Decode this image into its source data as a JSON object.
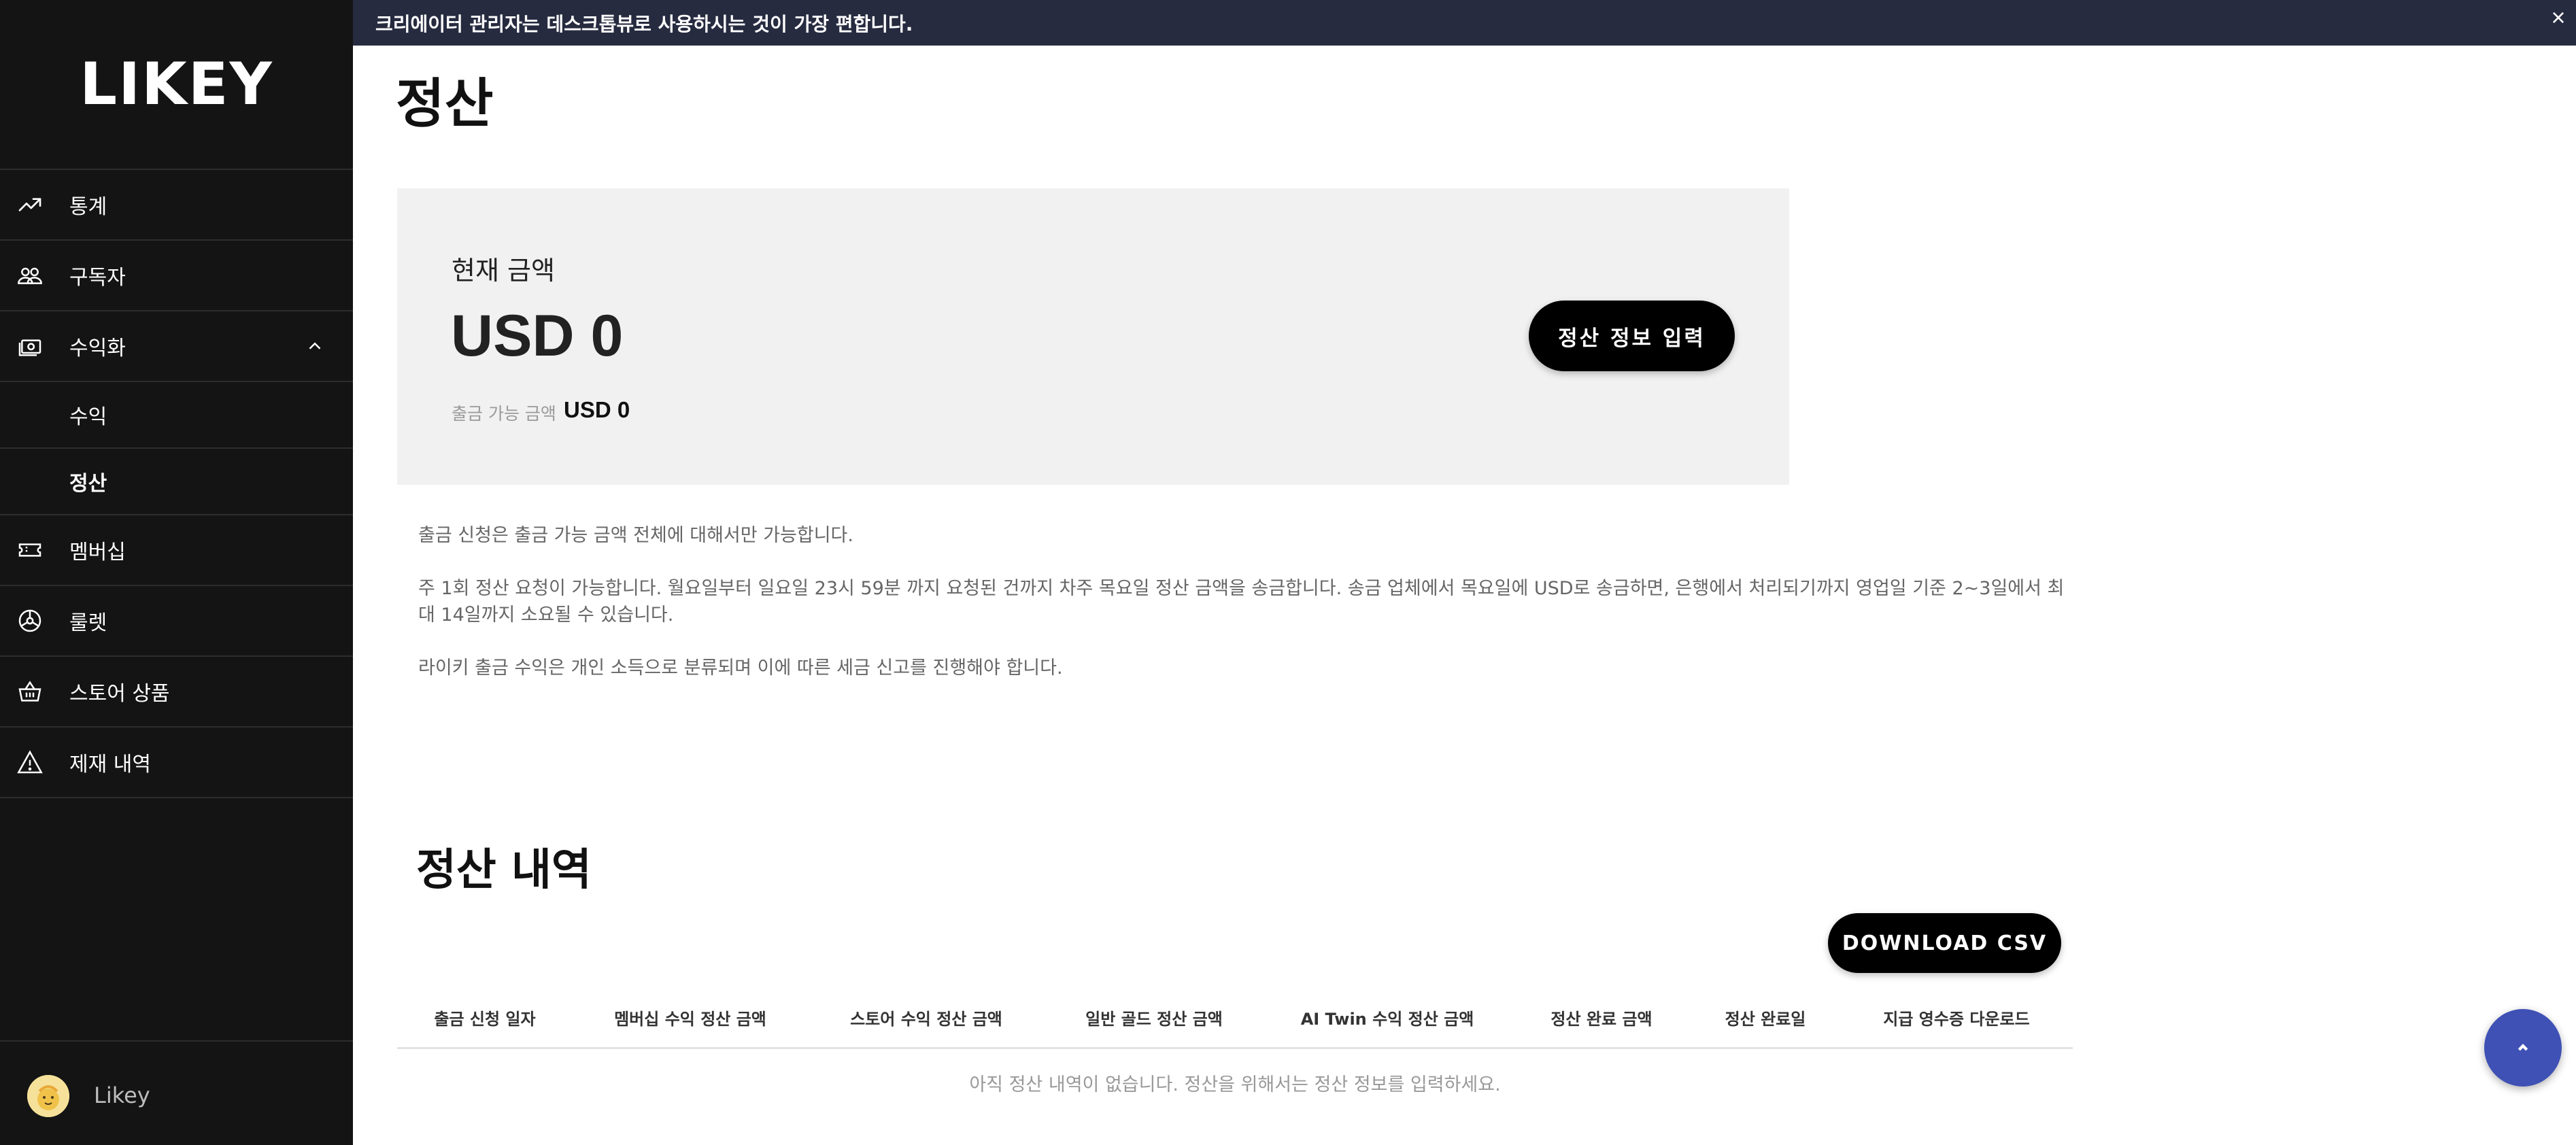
{
  "sidebar": {
    "logo": "LIKEY",
    "items": [
      {
        "label": "통계",
        "icon": "trending-up-icon"
      },
      {
        "label": "구독자",
        "icon": "users-icon"
      },
      {
        "label": "수익화",
        "icon": "money-icon",
        "expanded": true
      },
      {
        "label": "수익",
        "sub": true
      },
      {
        "label": "정산",
        "sub": true,
        "active": true
      },
      {
        "label": "멤버십",
        "icon": "ticket-icon"
      },
      {
        "label": "룰렛",
        "icon": "roulette-icon"
      },
      {
        "label": "스토어 상품",
        "icon": "basket-icon"
      },
      {
        "label": "제재 내역",
        "icon": "warning-icon"
      }
    ],
    "footer": {
      "name": "Likey"
    }
  },
  "banner": {
    "text": "크리에이터 관리자는 데스크톱뷰로 사용하시는 것이 가장 편합니다.",
    "close": "×"
  },
  "main": {
    "title": "정산",
    "card": {
      "label": "현재 금액",
      "amount": "USD 0",
      "available_label": "출금 가능 금액",
      "available_value": "USD 0",
      "button": "정산 정보 입력"
    },
    "notes": [
      "출금 신청은 출금 가능 금액 전체에 대해서만 가능합니다.",
      "주 1회 정산 요청이 가능합니다. 월요일부터 일요일 23시 59분 까지 요청된 건까지 차주 목요일 정산 금액을 송금합니다. 송금 업체에서 목요일에 USD로 송금하면, 은행에서 처리되기까지 영업일 기준 2~3일에서 최대 14일까지 소요될 수 있습니다.",
      "라이키 출금 수익은 개인 소득으로 분류되며 이에 따른 세금 신고를 진행해야 합니다."
    ],
    "history": {
      "title": "정산 내역",
      "download": "DOWNLOAD CSV",
      "columns": [
        "출금 신청 일자",
        "멤버십 수익 정산 금액",
        "스토어 수익 정산 금액",
        "일반 골드 정산 금액",
        "AI Twin 수익 정산 금액",
        "정산 완료 금액",
        "정산 완료일",
        "지급 영수증 다운로드"
      ],
      "empty": "아직 정산 내역이 없습니다. 정산을 위해서는 정산 정보를 입력하세요."
    }
  },
  "colors": {
    "sidebar": "#141414",
    "banner": "#272b40",
    "accent": "#3f51b5",
    "card": "#f1f1f1"
  }
}
